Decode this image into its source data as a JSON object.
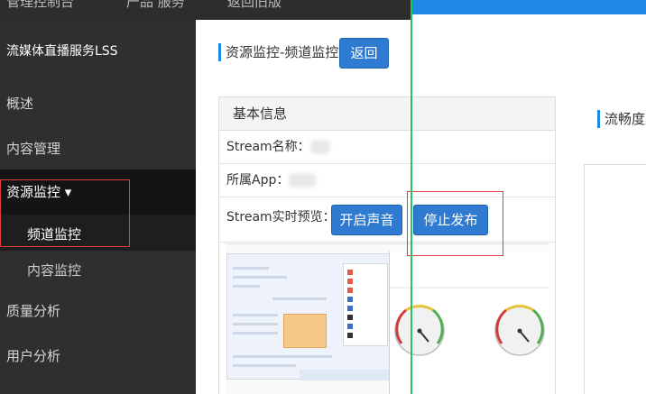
{
  "topbar": {
    "nav": [
      "管理控制台",
      "产品 服务",
      "返回旧版"
    ]
  },
  "sidebar": {
    "title": "流媒体直播服务LSS",
    "items": [
      {
        "label": "概述"
      },
      {
        "label": "内容管理"
      },
      {
        "label": "资源监控 ▾",
        "active": true
      },
      {
        "label": "频道监控",
        "sub": true,
        "active": true
      },
      {
        "label": "内容监控",
        "sub": true
      },
      {
        "label": "质量分析"
      },
      {
        "label": "用户分析"
      }
    ]
  },
  "main": {
    "page_title": "资源监控-频道监控",
    "back_label": "返回",
    "panel": {
      "title": "基本信息",
      "stream_label": "Stream名称：",
      "app_label": "所属App：",
      "preview_label": "Stream实时预览：",
      "sound_button": "开启声音",
      "stop_button": "停止发布"
    },
    "fluency_title": "流畅度监"
  },
  "colors": {
    "accent": "#1e88e5",
    "button": "#2e7bd1",
    "sidebar_bg": "#2f2f2f",
    "highlight_border": "#e23c3c",
    "overlay_line": "#22c55e"
  }
}
